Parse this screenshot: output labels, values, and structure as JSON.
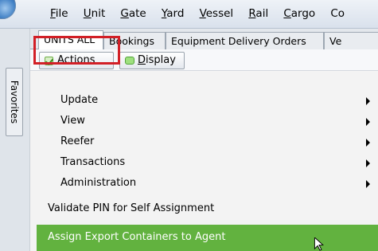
{
  "menubar": {
    "items": [
      {
        "acc": "F",
        "rest": "ile"
      },
      {
        "acc": "U",
        "rest": "nit"
      },
      {
        "acc": "G",
        "rest": "ate"
      },
      {
        "acc": "Y",
        "rest": "ard"
      },
      {
        "acc": "V",
        "rest": "essel"
      },
      {
        "acc": "R",
        "rest": "ail"
      },
      {
        "acc": "C",
        "rest": "argo"
      },
      {
        "acc": "",
        "rest": "Co"
      }
    ]
  },
  "favorites": {
    "label": "Favorites"
  },
  "tabs": [
    {
      "label": "UNITS ALL",
      "active": true
    },
    {
      "label": "Bookings",
      "active": false
    },
    {
      "label": "Equipment Delivery Orders",
      "active": false
    },
    {
      "label": "Ve",
      "active": false
    }
  ],
  "toolbar": {
    "actions": {
      "acc": "A",
      "rest": "ctions"
    },
    "display": {
      "acc": "D",
      "rest": "isplay"
    }
  },
  "menu": {
    "submenus": [
      "Update",
      "View",
      "Reefer",
      "Transactions",
      "Administration"
    ],
    "actions": [
      "Validate  PIN for Self Assignment",
      "Assign Export Containers to Agent"
    ],
    "selected_index": 1
  },
  "colors": {
    "highlight_box": "#d21f26",
    "selected_row": "#62b23f"
  }
}
